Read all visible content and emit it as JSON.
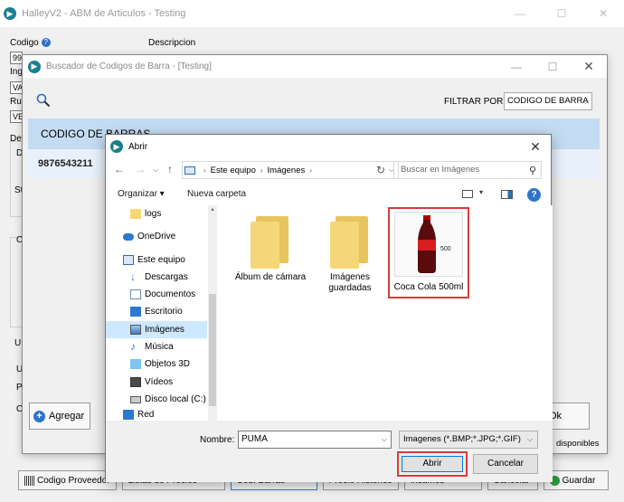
{
  "main_window": {
    "title": "HalleyV2 - ABM de Articulos - Testing",
    "codigo_label": "Codigo",
    "descripcion_label": "Descripcion",
    "codigo_value": "99",
    "field_ing_label": "Ing",
    "field_ing_value": "VA",
    "field_ru_label": "Ru",
    "field_ru_value": "VE",
    "group_de_label": "De",
    "group_d_label": "D",
    "group_st_label": "St",
    "group_c_label": "C",
    "group_u_label": "U",
    "group_u2_label": "U",
    "group_p_label": "P",
    "group_c2_label": "C",
    "bottom_buttons": [
      {
        "label": "Codigo Proveedor",
        "icon": "barcode-icon"
      },
      {
        "label": "Listas de Precios",
        "icon": "list-icon"
      },
      {
        "label": "Cod. Barras",
        "icon": "barcode-icon"
      },
      {
        "label": "Precio Historico",
        "icon": "history-icon"
      },
      {
        "label": "Insumos",
        "icon": "insumos-icon"
      },
      {
        "label": "Cancelar",
        "icon": "cancel-icon"
      },
      {
        "label": "Guardar",
        "icon": "check-icon"
      }
    ]
  },
  "barcode_dialog": {
    "title": "Buscador de Codigos de Barra - [Testing]",
    "filter_label": "FILTRAR POR",
    "filter_value": "CODIGO DE BARRA",
    "grid_header": "CODIGO DE BARRAS",
    "grid_rows": [
      "9876543211"
    ],
    "agregar_label": "Agregar",
    "ok_label": "Ok",
    "disponibles_label": "disponibles"
  },
  "open_dialog": {
    "title": "Abrir",
    "breadcrumb": [
      "Este equipo",
      "Imágenes"
    ],
    "search_placeholder": "Buscar en Imágenes",
    "organizar_label": "Organizar",
    "nueva_carpeta_label": "Nueva carpeta",
    "nav_items": [
      {
        "label": "logs",
        "icon": "folder-icon"
      },
      {
        "label": "OneDrive",
        "icon": "cloud-icon"
      },
      {
        "label": "Este equipo",
        "icon": "computer-icon"
      },
      {
        "label": "Descargas",
        "icon": "download-icon"
      },
      {
        "label": "Documentos",
        "icon": "documents-icon"
      },
      {
        "label": "Escritorio",
        "icon": "desktop-icon"
      },
      {
        "label": "Imágenes",
        "icon": "pictures-icon"
      },
      {
        "label": "Música",
        "icon": "music-icon"
      },
      {
        "label": "Objetos 3D",
        "icon": "cube-icon"
      },
      {
        "label": "Vídeos",
        "icon": "video-icon"
      },
      {
        "label": "Disco local (C:)",
        "icon": "drive-icon"
      },
      {
        "label": "Red",
        "icon": "network-icon"
      }
    ],
    "files": [
      {
        "label": "Álbum de cámara",
        "type": "folder"
      },
      {
        "label": "Imágenes guardadas",
        "type": "folder"
      },
      {
        "label": "Coca Cola 500ml",
        "type": "image",
        "thumb_text": "500"
      }
    ],
    "nombre_label": "Nombre:",
    "nombre_value": "PUMA",
    "filetype_value": "Imagenes (*.BMP;*.JPG;*.GIF)",
    "abrir_label": "Abrir",
    "cancelar_label": "Cancelar"
  },
  "colors": {
    "accent": "#0078d7",
    "highlight_red": "#d83b3b",
    "grid_header_bg": "#c4dcf2",
    "selected_nav_bg": "#cde8ff"
  }
}
